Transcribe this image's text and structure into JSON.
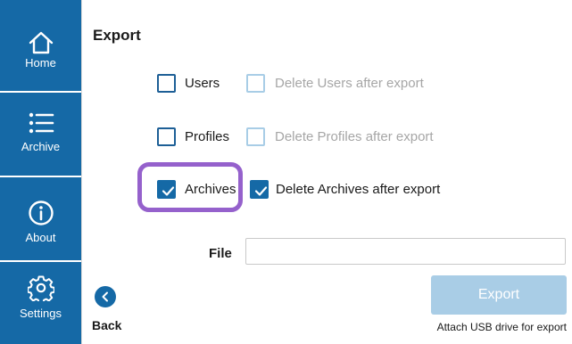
{
  "sidebar": {
    "items": [
      {
        "label": "Home",
        "icon": "home-icon"
      },
      {
        "label": "Archive",
        "icon": "list-icon"
      },
      {
        "label": "About",
        "icon": "info-icon"
      },
      {
        "label": "Settings",
        "icon": "gear-icon"
      }
    ],
    "background": "#1569a6"
  },
  "main": {
    "title": "Export",
    "options": [
      {
        "label": "Users",
        "checked": false,
        "delete_label": "Delete Users after export",
        "delete_checked": false,
        "delete_enabled": false
      },
      {
        "label": "Profiles",
        "checked": false,
        "delete_label": "Delete Profiles after export",
        "delete_checked": false,
        "delete_enabled": false
      },
      {
        "label": "Archives",
        "checked": true,
        "delete_label": "Delete Archives after export",
        "delete_checked": true,
        "delete_enabled": true
      }
    ],
    "file": {
      "label": "File",
      "value": "",
      "placeholder": ""
    }
  },
  "footer": {
    "back_label": "Back",
    "export_label": "Export",
    "export_enabled": false,
    "hint": "Attach USB drive for export"
  },
  "colors": {
    "primary": "#1569a6",
    "disabled_button": "#a9cde6",
    "highlight": "#9561cc"
  }
}
